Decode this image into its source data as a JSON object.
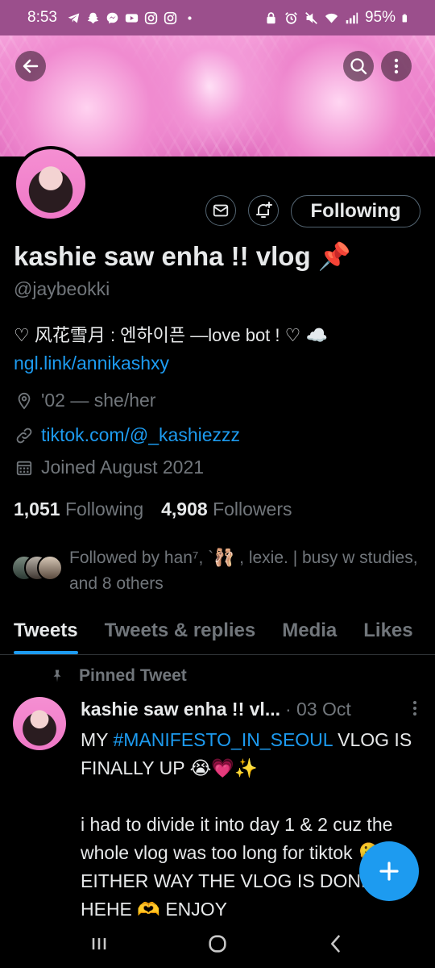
{
  "status_bar": {
    "time": "8:53",
    "battery": "95%",
    "left_icons": [
      "telegram-icon",
      "snapchat-icon",
      "messenger-icon",
      "youtube-icon",
      "instagram-icon",
      "instagram-icon",
      "dot-icon"
    ],
    "right_icons": [
      "lock-icon",
      "alarm-icon",
      "mute-icon",
      "wifi-icon",
      "signal-icon",
      "battery-icon"
    ]
  },
  "profile": {
    "display_name": "kashie saw enha !! vlog 📌",
    "handle": "@jaybeokki",
    "bio": "♡ 风花雪月 : 엔하이픈  —love bot ! ♡ ☁️",
    "bio_link": "ngl.link/annikashxy",
    "location": "'02 — she/her",
    "website": "tiktok.com/@_kashiezzz",
    "joined": "Joined August 2021",
    "following_count": "1,051",
    "following_label": "Following",
    "followers_count": "4,908",
    "followers_label": "Followers",
    "followed_by": "Followed by han⁷, `🩰 , lexie. | busy w studies, and 8 others",
    "follow_button": "Following"
  },
  "tabs": [
    {
      "label": "Tweets",
      "active": true
    },
    {
      "label": "Tweets & replies",
      "active": false
    },
    {
      "label": "Media",
      "active": false
    },
    {
      "label": "Likes",
      "active": false
    }
  ],
  "pinned_tweet": {
    "pinned_label": "Pinned Tweet",
    "author": "kashie saw enha !! vl...",
    "date": "· 03 Oct",
    "text_before_tag": "MY ",
    "hashtag": "#MANIFESTO_IN_SEOUL",
    "text_after_tag": " VLOG IS FINALLY UP 😭💗✨\n\ni had to divide it into day 1 & 2 cuz the whole vlog was too long for tiktok 🫠  EITHER WAY THE VLOG IS DONEE HEHE 🫶 ENJOY"
  },
  "colors": {
    "accent": "#1d9bf0",
    "status_bar": "#9b4f8c",
    "muted_text": "#71767b",
    "background": "#000000"
  }
}
